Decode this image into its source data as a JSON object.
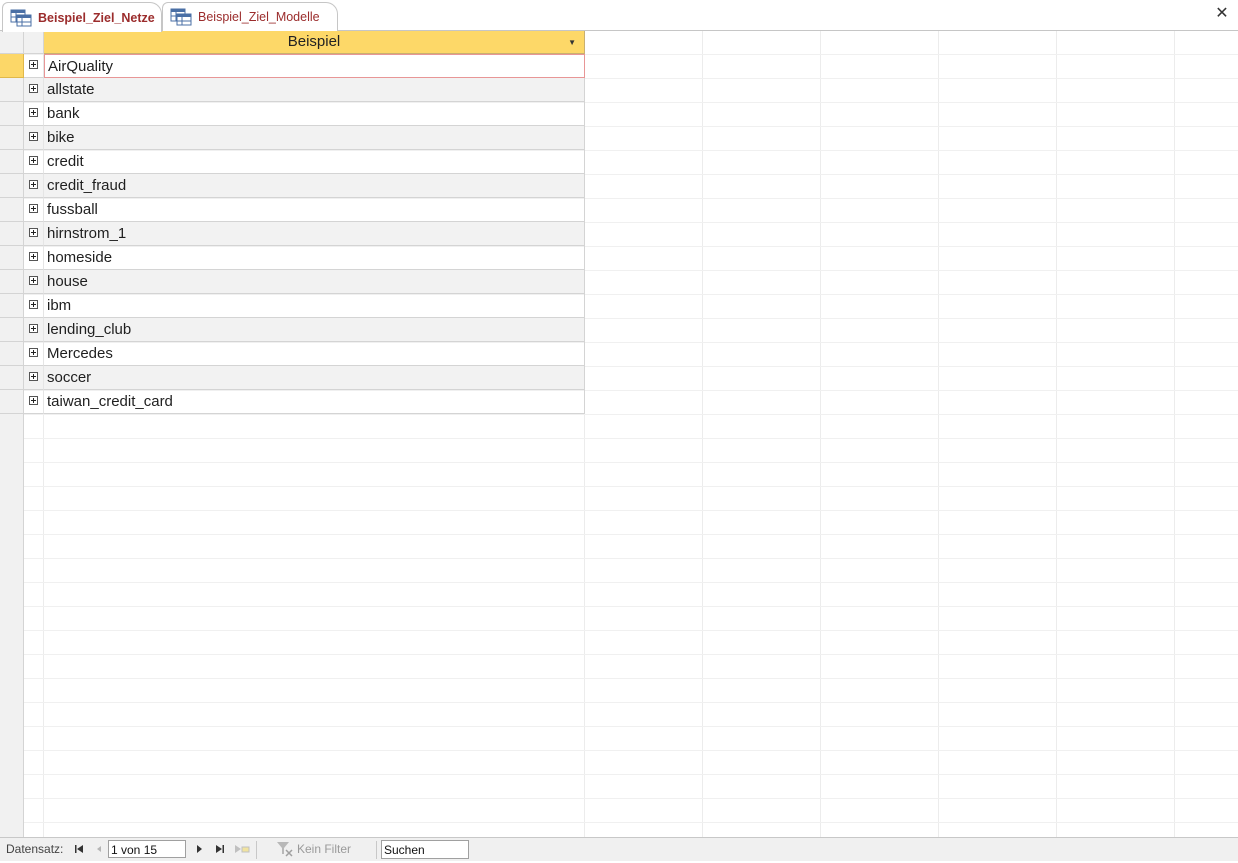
{
  "tabs": [
    {
      "label": "Beispiel_Ziel_Netze",
      "active": true
    },
    {
      "label": "Beispiel_Ziel_Modelle",
      "active": false
    }
  ],
  "close_symbol": "✕",
  "datasheet": {
    "column_header": "Beispiel",
    "rows": [
      "AirQuality",
      "allstate",
      "bank",
      "bike",
      "credit",
      "credit_fraud",
      "fussball",
      "hirnstrom_1",
      "homeside",
      "house",
      "ibm",
      "lending_club",
      "Mercedes",
      "soccer",
      "taiwan_credit_card"
    ],
    "current_row_index": 0
  },
  "statusbar": {
    "record_label": "Datensatz:",
    "record_position": "1 von 15",
    "filter_label": "Kein Filter",
    "search_value": "Suchen"
  },
  "colors": {
    "tab_text": "#9b2c2c",
    "header_bg": "#fdd868",
    "current_row_selector": "#fcd768",
    "current_cell_border": "#e89696"
  },
  "icons": {
    "tab": "table-icon",
    "close": "close-icon",
    "expand": "expand-plus-icon",
    "filter": "filter-off-icon"
  }
}
